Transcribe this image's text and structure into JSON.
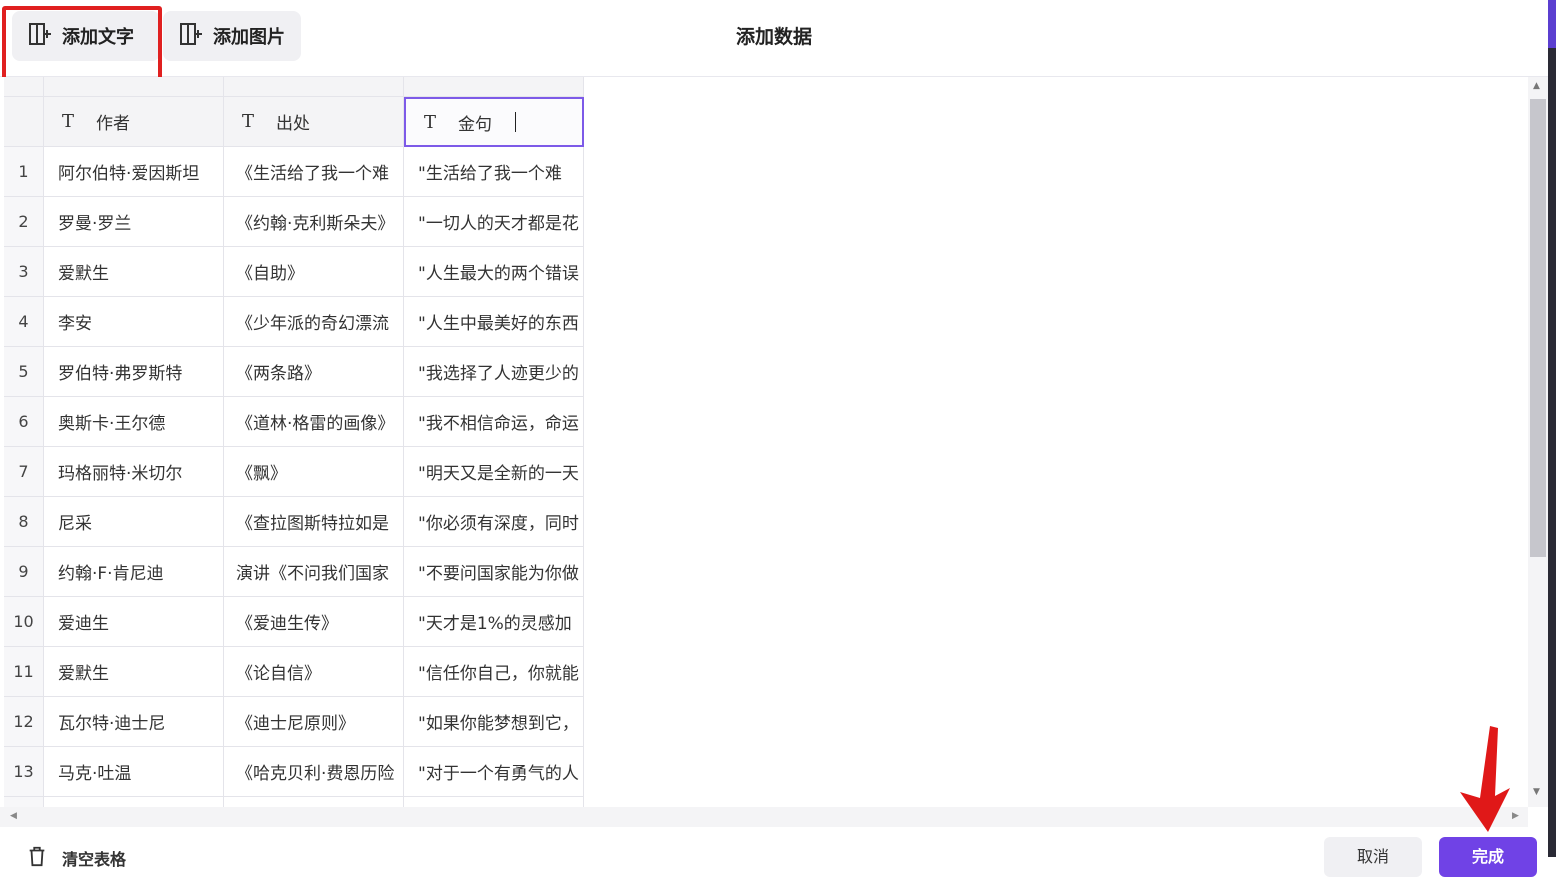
{
  "dialog": {
    "title": "添加数据"
  },
  "toolbar": {
    "add_text_label": "添加文字",
    "add_image_label": "添加图片"
  },
  "table": {
    "type_icon": "T",
    "columns": [
      "作者",
      "出处",
      "金句"
    ],
    "rows": [
      {
        "num": "1",
        "author": "阿尔伯特·爱因斯坦",
        "source": "《生活给了我一个难",
        "quote": "\"生活给了我一个难"
      },
      {
        "num": "2",
        "author": "罗曼·罗兰",
        "source": "《约翰·克利斯朵夫》",
        "quote": "\"一切人的天才都是花"
      },
      {
        "num": "3",
        "author": "爱默生",
        "source": "《自助》",
        "quote": "\"人生最大的两个错误"
      },
      {
        "num": "4",
        "author": "李安",
        "source": "《少年派的奇幻漂流",
        "quote": "\"人生中最美好的东西"
      },
      {
        "num": "5",
        "author": "罗伯特·弗罗斯特",
        "source": "《两条路》",
        "quote": "\"我选择了人迹更少的"
      },
      {
        "num": "6",
        "author": "奥斯卡·王尔德",
        "source": "《道林·格雷的画像》",
        "quote": "\"我不相信命运，命运"
      },
      {
        "num": "7",
        "author": "玛格丽特·米切尔",
        "source": "《飘》",
        "quote": "\"明天又是全新的一天"
      },
      {
        "num": "8",
        "author": "尼采",
        "source": "《查拉图斯特拉如是",
        "quote": "\"你必须有深度，同时"
      },
      {
        "num": "9",
        "author": "约翰·F·肯尼迪",
        "source": "演讲《不问我们国家",
        "quote": "\"不要问国家能为你做"
      },
      {
        "num": "10",
        "author": "爱迪生",
        "source": "《爱迪生传》",
        "quote": "\"天才是1%的灵感加"
      },
      {
        "num": "11",
        "author": "爱默生",
        "source": "《论自信》",
        "quote": "\"信任你自己，你就能"
      },
      {
        "num": "12",
        "author": "瓦尔特·迪士尼",
        "source": "《迪士尼原则》",
        "quote": "\"如果你能梦想到它，"
      },
      {
        "num": "13",
        "author": "马克·吐温",
        "source": "《哈克贝利·费恩历险",
        "quote": "\"对于一个有勇气的人"
      }
    ]
  },
  "footer": {
    "clear_label": "清空表格",
    "cancel_label": "取消",
    "done_label": "完成"
  },
  "colors": {
    "accent": "#7042e6",
    "highlight": "#e02020",
    "active_border": "#7d5ae8"
  },
  "icons": [
    "add-text-icon",
    "add-image-icon",
    "trash-icon"
  ]
}
